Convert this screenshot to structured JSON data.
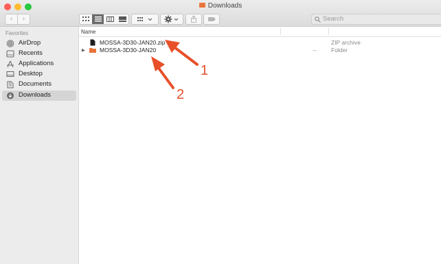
{
  "window": {
    "title": "Downloads",
    "traffic_lights": [
      "#fe5f57",
      "#febc2e",
      "#28c840"
    ]
  },
  "toolbar": {
    "back_label": "‹",
    "forward_label": "›",
    "view_modes": [
      "icon-view",
      "list-view",
      "column-view",
      "gallery-view"
    ],
    "active_view": "list-view"
  },
  "search": {
    "placeholder": "Search"
  },
  "sidebar": {
    "section_label": "Favorites",
    "items": [
      {
        "label": "AirDrop",
        "icon": "airdrop-icon"
      },
      {
        "label": "Recents",
        "icon": "recents-icon"
      },
      {
        "label": "Applications",
        "icon": "applications-icon"
      },
      {
        "label": "Desktop",
        "icon": "desktop-icon"
      },
      {
        "label": "Documents",
        "icon": "documents-icon"
      },
      {
        "label": "Downloads",
        "icon": "downloads-icon",
        "selected": true
      }
    ]
  },
  "list": {
    "column_name": "Name",
    "rows": [
      {
        "name": "MOSSA-3D30-JAN20.zip",
        "size": "",
        "kind": "ZIP archive",
        "icon": "zip-file-icon"
      },
      {
        "name": "MOSSA-3D30-JAN20",
        "size": "--",
        "kind": "Folder",
        "icon": "folder-icon"
      }
    ]
  },
  "annotations": {
    "label_1": "1",
    "label_2": "2",
    "color": "#e8502a"
  }
}
